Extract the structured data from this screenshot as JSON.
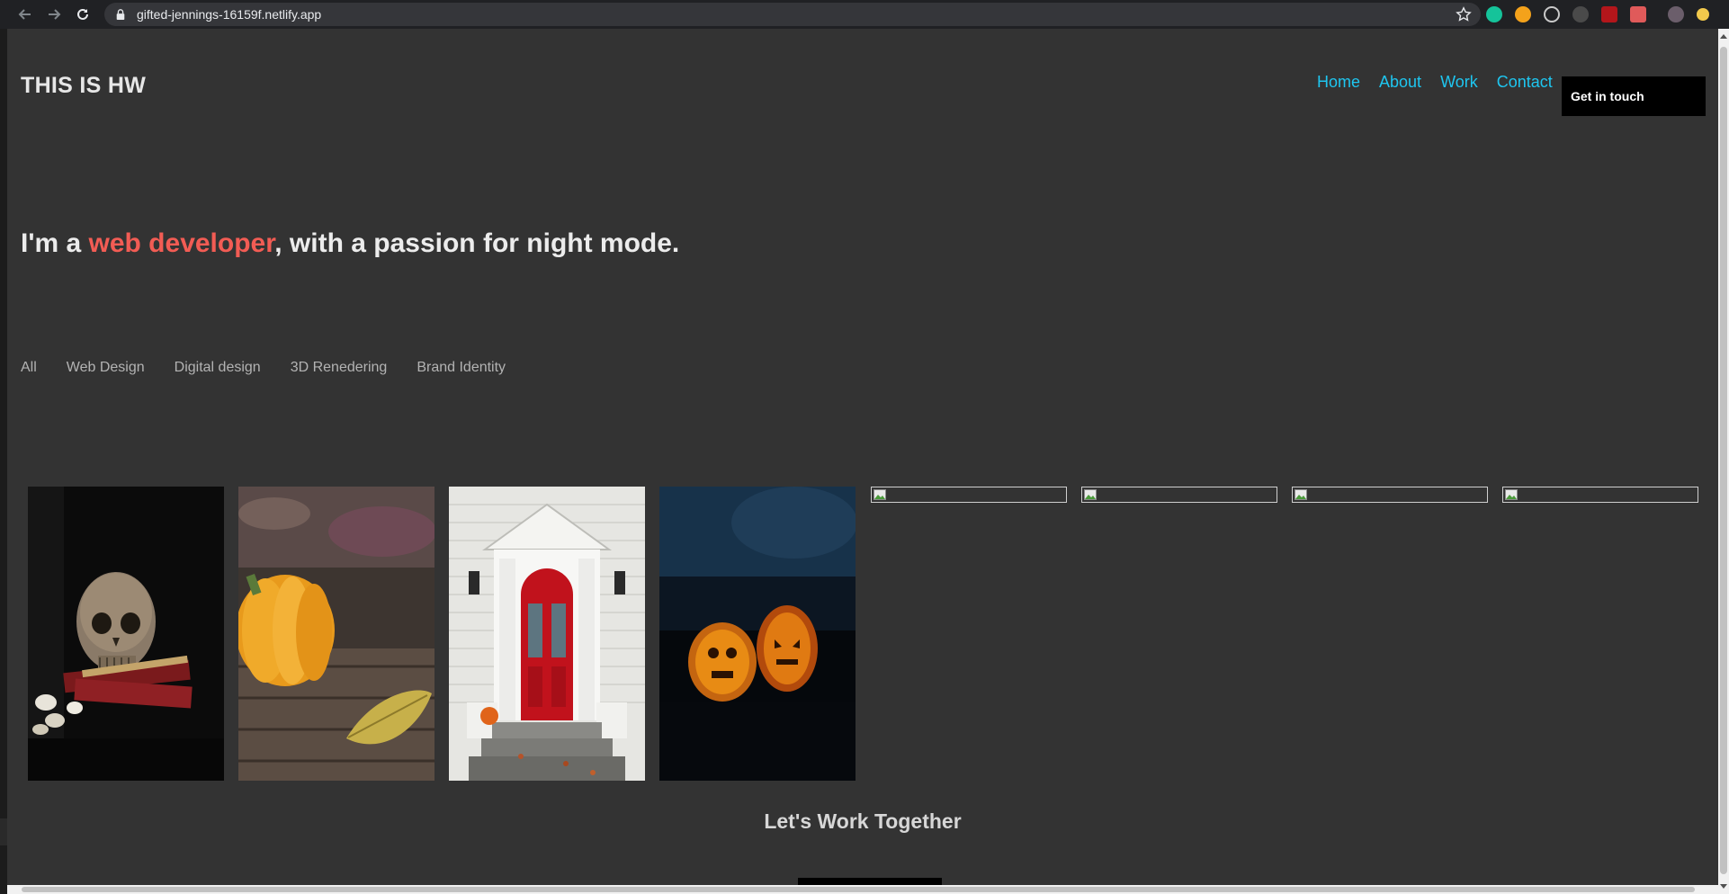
{
  "browser": {
    "url": "gifted-jennings-16159f.netlify.app",
    "icons": [
      "back-arrow-icon",
      "forward-arrow-icon",
      "reload-icon",
      "lock-icon",
      "bookmark-star-icon"
    ],
    "extensions": [
      "grammarly-icon",
      "blocker-icon",
      "react-devtools-icon",
      "extension-icon",
      "pdf-icon",
      "video-icon",
      "profile-avatar-icon",
      "update-badge-icon"
    ]
  },
  "site": {
    "brand": "THIS IS HW",
    "nav": [
      "Home",
      "About",
      "Work",
      "Contact"
    ],
    "cta_label": "Get in touch",
    "colors": {
      "background": "#333333",
      "nav_link": "#1ec6f0",
      "accent": "#f25c54",
      "button": "#000000"
    }
  },
  "hero": {
    "prefix": "I'm a ",
    "highlight": "web developer",
    "suffix": ", with a passion for night mode."
  },
  "filters": [
    "All",
    "Web Design",
    "Digital design",
    "3D Renedering",
    "Brand Identity"
  ],
  "gallery": [
    {
      "name": "gallery-photo-skull",
      "status": "loaded"
    },
    {
      "name": "gallery-photo-pumpkin",
      "status": "loaded"
    },
    {
      "name": "gallery-photo-red-door",
      "status": "loaded"
    },
    {
      "name": "gallery-photo-jack-o-lanterns",
      "status": "loaded"
    },
    {
      "name": "gallery-image-broken-1",
      "status": "broken"
    },
    {
      "name": "gallery-image-broken-2",
      "status": "broken"
    },
    {
      "name": "gallery-image-broken-3",
      "status": "broken"
    },
    {
      "name": "gallery-image-broken-4",
      "status": "broken"
    }
  ],
  "footer_cta": {
    "title": "Let's Work Together"
  }
}
